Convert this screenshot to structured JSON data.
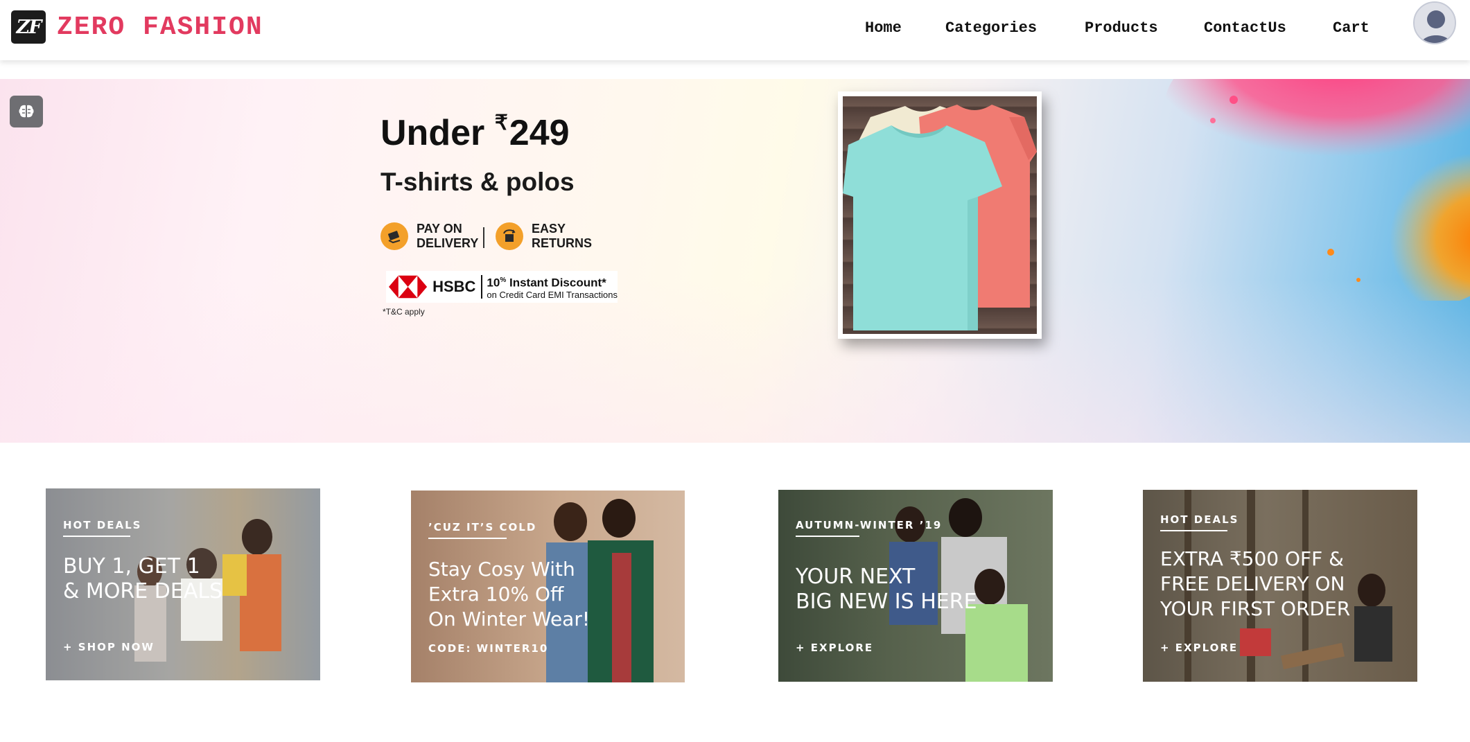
{
  "brand": {
    "logo_mark": "ZF",
    "name": "ZERO FASHION",
    "color": "#e23a5f"
  },
  "nav": {
    "items": [
      {
        "label": "Home"
      },
      {
        "label": "Categories"
      },
      {
        "label": "Products"
      },
      {
        "label": "ContactUs"
      },
      {
        "label": "Cart"
      }
    ],
    "avatar_icon": "user-avatar-icon"
  },
  "hero": {
    "button_icon": "brain-icon",
    "title_prefix": "Under ",
    "currency": "₹",
    "price": "249",
    "subtitle": "T-shirts & polos",
    "perks": [
      {
        "icon": "cash-on-delivery-icon",
        "text": "PAY ON\nDELIVERY"
      },
      {
        "icon": "return-box-icon",
        "text": "EASY\nRETURNS"
      }
    ],
    "bank": {
      "name": "HSBC",
      "offer_percent": "10",
      "offer_sup": "%",
      "offer_text": " Instant Discount*",
      "offer_detail": "on Credit Card EMI Transactions"
    },
    "tc": "*T&C apply"
  },
  "promos": [
    {
      "tag": "HOT DEALS",
      "headline": "BUY 1, GET 1\n& MORE DEALS",
      "cta": "+ SHOP NOW"
    },
    {
      "tag": "’CUZ IT’S COLD",
      "headline": "Stay Cosy With\nExtra 10% Off\nOn Winter Wear!",
      "cta": "CODE: WINTER10"
    },
    {
      "tag": "AUTUMN-WINTER ’19",
      "headline": "YOUR NEXT\nBIG NEW IS HERE",
      "cta": "+ EXPLORE"
    },
    {
      "tag": "HOT DEALS",
      "headline": "EXTRA ₹500 OFF &\nFREE DELIVERY ON\nYOUR FIRST ORDER",
      "cta": "+ EXPLORE"
    }
  ]
}
